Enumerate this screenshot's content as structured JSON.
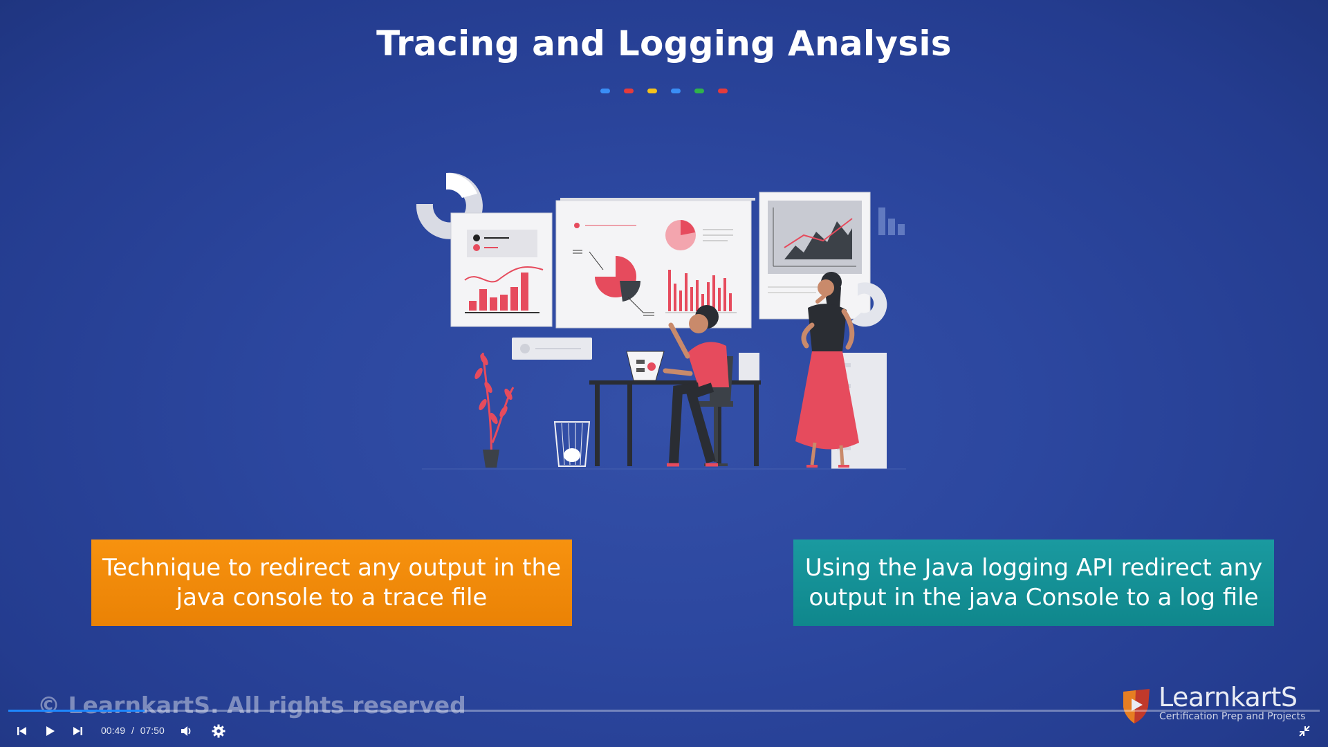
{
  "slide": {
    "title": "Tracing and Logging Analysis",
    "dot_colors": [
      "#3a8ef6",
      "#e53b3b",
      "#f5c21b",
      "#3a8ef6",
      "#2fb24a",
      "#e53b3b"
    ],
    "boxes": {
      "left": {
        "lines": [
          "Technique to redirect any output in the",
          "java console to a trace file"
        ],
        "color": "#f7920f"
      },
      "right": {
        "lines": [
          "Using the Java logging API redirect any",
          "output in the java Console to a log file"
        ],
        "color": "#138f94"
      }
    }
  },
  "watermark": "© LearnkartS. All rights reserved",
  "logo": {
    "name": "LearnkartS",
    "tagline": "Certification Prep and Projects"
  },
  "player": {
    "current_time": "00:49",
    "separator": "/",
    "duration": "07:50",
    "progress": 0.104,
    "accent_color": "#1e88ff",
    "icons": [
      "skip-back-icon",
      "play-icon",
      "skip-forward-icon",
      "volume-icon",
      "settings-icon",
      "exit-fullscreen-icon"
    ]
  }
}
